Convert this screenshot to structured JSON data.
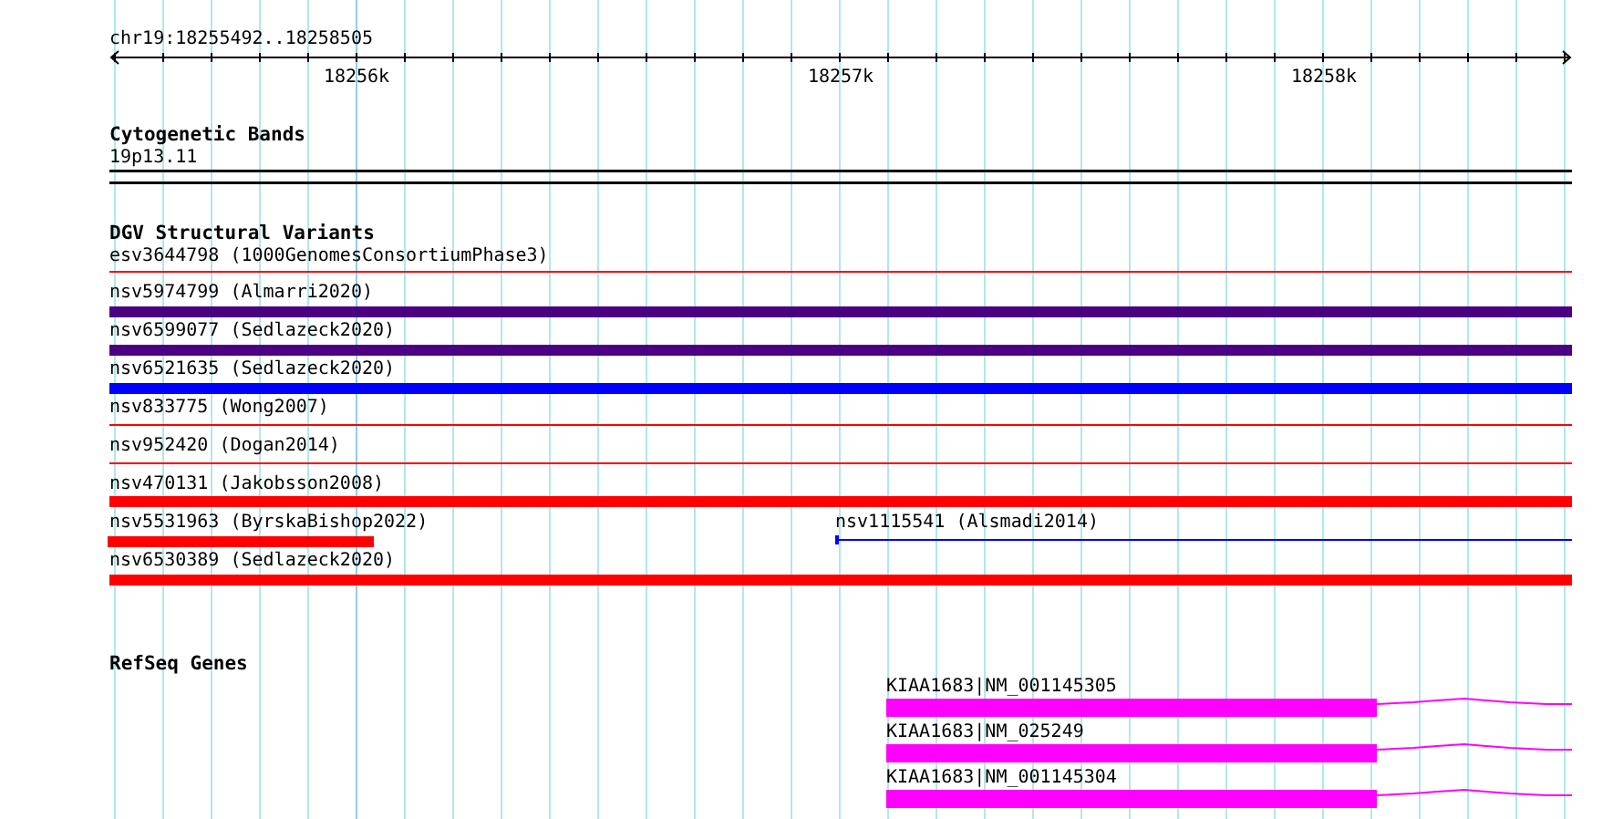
{
  "ruler": {
    "location": "chr19:18255492..18258505",
    "ticks": [
      "18256k",
      "18257k",
      "18258k"
    ]
  },
  "tracks": [
    {
      "title": "Cytogenetic Bands",
      "kind": "bands",
      "features": [
        {
          "label": "19p13.11"
        }
      ]
    },
    {
      "title": "DGV Structural Variants",
      "kind": "variants",
      "features": [
        {
          "label": "esv3644798 (1000GenomesConsortiumPhase3)",
          "kind": "line",
          "color": "#ff0000"
        },
        {
          "label": "nsv5974799 (Almarri2020)",
          "kind": "bar",
          "color": "#4b0082"
        },
        {
          "label": "nsv6599077 (Sedlazeck2020)",
          "kind": "bar",
          "color": "#4b0082"
        },
        {
          "label": "nsv6521635 (Sedlazeck2020)",
          "kind": "bar",
          "color": "#0000ff"
        },
        {
          "label": "nsv833775 (Wong2007)",
          "kind": "line",
          "color": "#ff0000"
        },
        {
          "label": "nsv952420 (Dogan2014)",
          "kind": "line",
          "color": "#ff0000"
        },
        {
          "label": "nsv470131 (Jakobsson2008)",
          "kind": "bar",
          "color": "#ff0000"
        },
        {
          "label": "nsv5531963 (ByrskaBishop2022)",
          "kind": "bar",
          "color": "#ff0000"
        },
        {
          "label": "nsv1115541 (Alsmadi2014)",
          "kind": "line",
          "color": "#0000ff"
        },
        {
          "label": "nsv6530389 (Sedlazeck2020)",
          "kind": "bar",
          "color": "#ff0000"
        }
      ]
    },
    {
      "title": "RefSeq Genes",
      "kind": "genes",
      "features": [
        {
          "label": "KIAA1683|NM_001145305"
        },
        {
          "label": "KIAA1683|NM_025249"
        },
        {
          "label": "KIAA1683|NM_001145304"
        }
      ]
    }
  ]
}
